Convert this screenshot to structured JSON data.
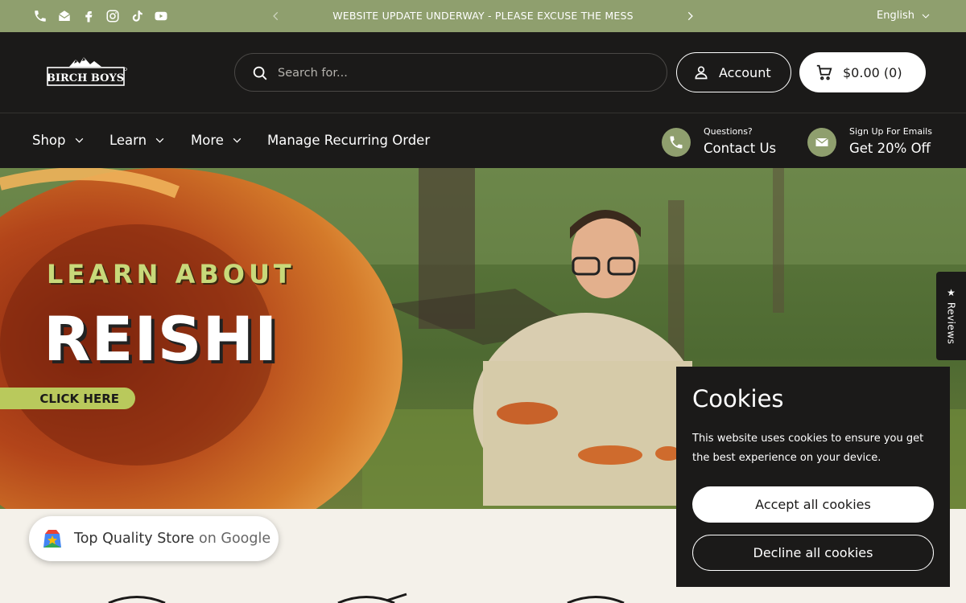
{
  "announcement": {
    "text": "WEBSITE UPDATE UNDERWAY - PLEASE EXCUSE THE MESS",
    "language": "English",
    "social_icons": [
      "phone-icon",
      "email-icon",
      "facebook-icon",
      "instagram-icon",
      "tiktok-icon",
      "youtube-icon"
    ]
  },
  "header": {
    "logo_text": "BIRCH BOYS",
    "search_placeholder": "Search for...",
    "account_label": "Account",
    "cart_label": "$0.00 (0)"
  },
  "nav": {
    "items": [
      {
        "label": "Shop",
        "dropdown": true
      },
      {
        "label": "Learn",
        "dropdown": true
      },
      {
        "label": "More",
        "dropdown": true
      },
      {
        "label": "Manage Recurring Order",
        "dropdown": false
      }
    ],
    "contact": {
      "small": "Questions?",
      "big": "Contact Us"
    },
    "emails": {
      "small": "Sign Up For Emails",
      "big": "Get 20% Off"
    }
  },
  "hero": {
    "line1": "LEARN ABOUT",
    "line2": "REISHI",
    "cta": "CLICK HERE"
  },
  "reviews_tab": "★ Reviews",
  "cookies": {
    "title": "Cookies",
    "body": "This website uses cookies to ensure you get the best experience on your device.",
    "accept": "Accept all cookies",
    "decline": "Decline all cookies"
  },
  "google_badge": {
    "text1": "Top Quality Store",
    "text2": "on Google"
  },
  "colors": {
    "accent_green": "#8f9f6e",
    "dark": "#1b1a19",
    "cream": "#f4f1ea",
    "cta_lime": "#b9c95c"
  }
}
